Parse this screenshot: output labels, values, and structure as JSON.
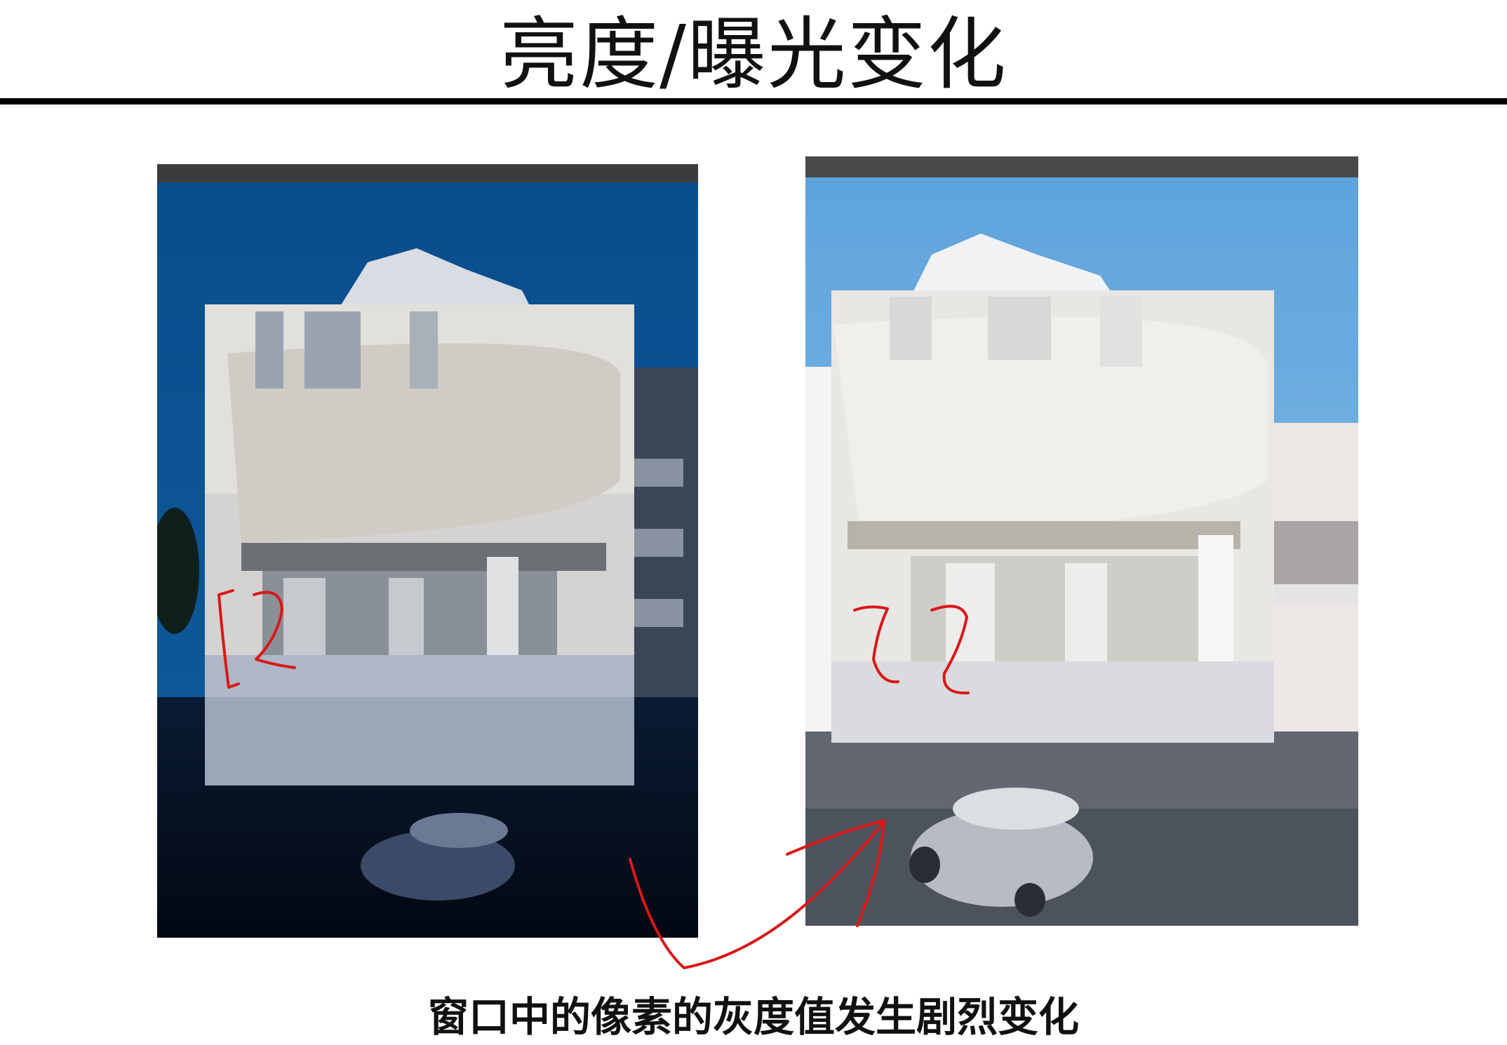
{
  "slide": {
    "title": "亮度/曝光变化",
    "caption": "窗口中的像素的灰度值发生剧烈变化"
  },
  "images": [
    {
      "id": "dark",
      "exposure": "low"
    },
    {
      "id": "bright",
      "exposure": "high"
    }
  ],
  "annotations": {
    "color": "#d81818",
    "marks": [
      "bracket-left",
      "bracket-right",
      "arrow"
    ]
  }
}
